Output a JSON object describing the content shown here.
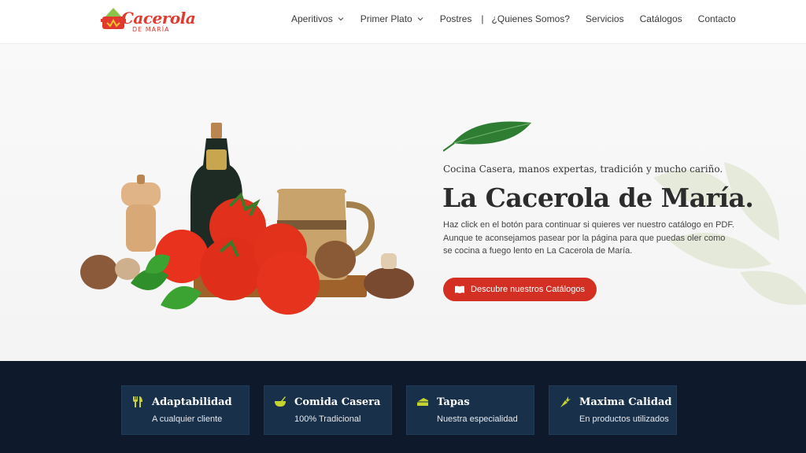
{
  "header": {
    "logo_text": "Cacerola",
    "logo_subtext": "DE MARÍA",
    "nav": [
      {
        "label": "Aperitivos",
        "has_dropdown": true
      },
      {
        "label": "Primer Plato",
        "has_dropdown": true
      },
      {
        "label": "Postres",
        "has_dropdown": false
      },
      {
        "label": "¿Quienes Somos?",
        "has_dropdown": false
      },
      {
        "label": "Servicios",
        "has_dropdown": false
      },
      {
        "label": "Catálogos",
        "has_dropdown": false
      },
      {
        "label": "Contacto",
        "has_dropdown": false
      }
    ],
    "separator": "|"
  },
  "hero": {
    "tagline": "Cocina Casera, manos expertas, tradición y mucho cariño.",
    "title": "La Cacerola de María.",
    "text": "Haz click en el botón para continuar si quieres ver nuestro catálogo en PDF. Aunque te aconsejamos pasear por la página para que puedas oler como se cocina a fuego lento en La Cacerola de María.",
    "cta_label": "Descubre nuestros Catálogos",
    "cta_icon": "book-icon"
  },
  "features": [
    {
      "title": "Adaptabilidad",
      "subtitle": "A cualquier cliente",
      "icon": "utensils-icon"
    },
    {
      "title": "Comida Casera",
      "subtitle": "100% Tradicional",
      "icon": "mortar-icon"
    },
    {
      "title": "Tapas",
      "subtitle": "Nuestra especialidad",
      "icon": "cheese-icon"
    },
    {
      "title": "Maxima Calidad",
      "subtitle": "En productos utilizados",
      "icon": "carrot-icon"
    }
  ],
  "colors": {
    "accent": "#d32f22",
    "feature_bg": "#0e1a2c",
    "card_bg": "#18304a",
    "icon_yellow": "#c6d32e"
  }
}
